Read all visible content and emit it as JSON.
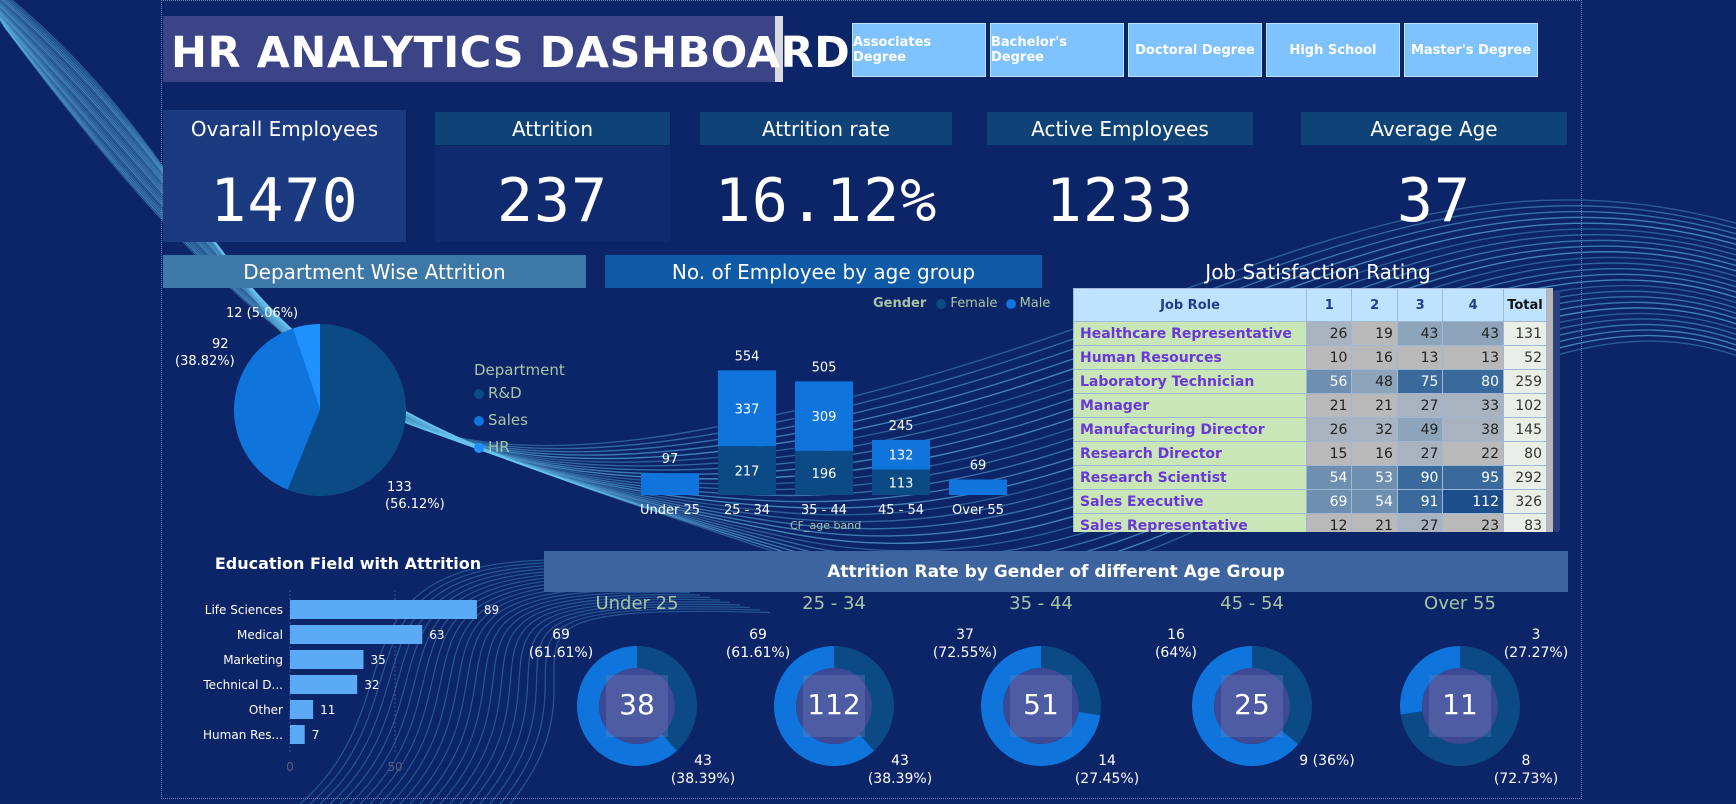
{
  "dashboard": {
    "title": "HR ANALYTICS DASHBOARD"
  },
  "slicers": [
    "Associates Degree",
    "Bachelor's Degree",
    "Doctoral Degree",
    "High School",
    "Master's Degree"
  ],
  "kpis": [
    {
      "label": "Ovarall Employees",
      "value": "1470"
    },
    {
      "label": "Attrition",
      "value": "237"
    },
    {
      "label": "Attrition rate",
      "value": "16.12%"
    },
    {
      "label": "Active Employees",
      "value": "1233"
    },
    {
      "label": "Average Age",
      "value": "37"
    }
  ],
  "dept": {
    "title": "Department Wise Attrition",
    "legend_title": "Department",
    "legend": [
      "R&D",
      "Sales",
      "HR"
    ],
    "labels": {
      "rd": [
        "133",
        "(56.12%)"
      ],
      "sales": [
        "92",
        "(38.82%)"
      ],
      "hr": "12 (5.06%)"
    }
  },
  "age_chart": {
    "title": "No. of Employee by age group",
    "legend_title": "Gender",
    "legend": [
      "Female",
      "Male"
    ],
    "xaxis_label": "CF_age band"
  },
  "edu": {
    "title": "Education Field with Attrition",
    "axis_ticks": [
      "0",
      "50"
    ]
  },
  "gender_rate": {
    "title": "Attrition Rate by Gender of different Age Group",
    "groups": [
      {
        "band": "Under 25",
        "center": "38",
        "top_val": "69",
        "top_pct": "(61.61%)",
        "bot_val": "43",
        "bot_pct": "(38.39%)"
      },
      {
        "band": "25 - 34",
        "center": "112",
        "top_val": "69",
        "top_pct": "(61.61%)",
        "bot_val": "43",
        "bot_pct": "(38.39%)"
      },
      {
        "band": "35 - 44",
        "center": "51",
        "top_val": "37",
        "top_pct": "(72.55%)",
        "bot_val": "14",
        "bot_pct": "(27.45%)"
      },
      {
        "band": "45 - 54",
        "center": "25",
        "top_val": "16",
        "top_pct": "(64%)",
        "bot_val": "9 (36%)",
        "bot_pct": ""
      },
      {
        "band": "Over 55",
        "center": "11",
        "top_val": "3",
        "top_pct": "(27.27%)",
        "bot_val": "8",
        "bot_pct": "(72.73%)"
      }
    ]
  },
  "job_sat": {
    "title": "Job Satisfaction Rating",
    "columns": [
      "Job Role",
      "1",
      "2",
      "3",
      "4",
      "Total"
    ],
    "rows": [
      {
        "role": "Healthcare Representative",
        "v": [
          "26",
          "19",
          "43",
          "43"
        ],
        "total": "131"
      },
      {
        "role": "Human Resources",
        "v": [
          "10",
          "16",
          "13",
          "13"
        ],
        "total": "52"
      },
      {
        "role": "Laboratory Technician",
        "v": [
          "56",
          "48",
          "75",
          "80"
        ],
        "total": "259"
      },
      {
        "role": "Manager",
        "v": [
          "21",
          "21",
          "27",
          "33"
        ],
        "total": "102"
      },
      {
        "role": "Manufacturing Director",
        "v": [
          "26",
          "32",
          "49",
          "38"
        ],
        "total": "145"
      },
      {
        "role": "Research Director",
        "v": [
          "15",
          "16",
          "27",
          "22"
        ],
        "total": "80"
      },
      {
        "role": "Research Scientist",
        "v": [
          "54",
          "53",
          "90",
          "95"
        ],
        "total": "292"
      },
      {
        "role": "Sales Executive",
        "v": [
          "69",
          "54",
          "91",
          "112"
        ],
        "total": "326"
      },
      {
        "role": "Sales Representative",
        "v": [
          "12",
          "21",
          "27",
          "23"
        ],
        "total": "83"
      }
    ]
  },
  "chart_data": [
    {
      "type": "pie",
      "title": "Department Wise Attrition",
      "categories": [
        "R&D",
        "Sales",
        "HR"
      ],
      "values": [
        133,
        92,
        12
      ],
      "colors": [
        "#0c4a86",
        "#0f74db",
        "#1e90ff"
      ]
    },
    {
      "type": "bar",
      "title": "No. of Employee by age group",
      "xlabel": "CF_age band",
      "categories": [
        "Under 25",
        "25 - 34",
        "35 - 44",
        "45 - 54",
        "Over 55"
      ],
      "series": [
        {
          "name": "Female",
          "values": [
            null,
            217,
            196,
            113,
            null
          ]
        },
        {
          "name": "Male",
          "values": [
            null,
            337,
            309,
            132,
            null
          ]
        }
      ],
      "totals": [
        97,
        554,
        505,
        245,
        69
      ],
      "colors": [
        "#0c4a86",
        "#0f74db"
      ]
    },
    {
      "type": "bar",
      "title": "Education Field with Attrition",
      "categories": [
        "Life Sciences",
        "Medical",
        "Marketing",
        "Technical D...",
        "Other",
        "Human Res..."
      ],
      "values": [
        89,
        63,
        35,
        32,
        11,
        7
      ],
      "xlim": [
        0,
        95
      ],
      "color": "#5aaaf5"
    },
    {
      "type": "pie",
      "title": "Attrition Rate by Gender of different Age Group",
      "categories": [
        "Under 25",
        "25 - 34",
        "35 - 44",
        "45 - 54",
        "Over 55"
      ],
      "series": [
        {
          "name": "Male",
          "values": [
            69,
            69,
            37,
            16,
            3
          ]
        },
        {
          "name": "Female",
          "values": [
            43,
            43,
            14,
            9,
            8
          ]
        }
      ],
      "colors": [
        "#0f74db",
        "#0c4a86"
      ]
    }
  ]
}
